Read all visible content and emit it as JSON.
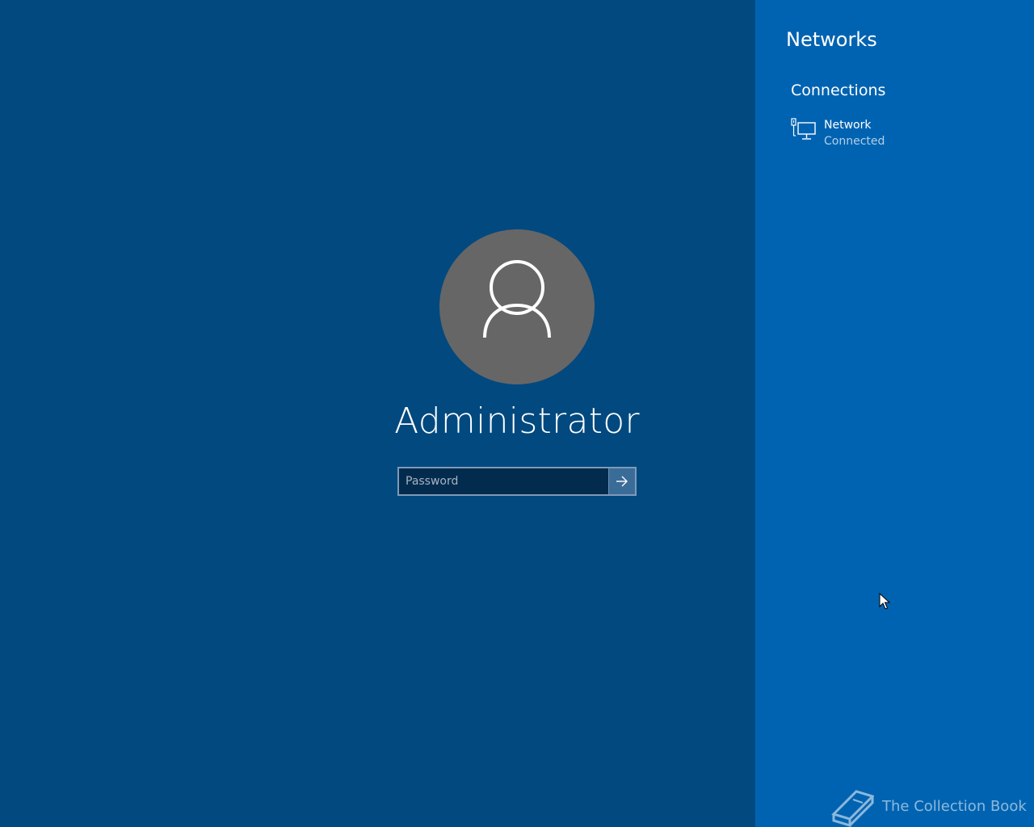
{
  "login": {
    "username": "Administrator",
    "password_placeholder": "Password",
    "password_value": "",
    "avatar_icon": "user-silhouette-icon",
    "submit_icon": "arrow-right-icon"
  },
  "networks_panel": {
    "title": "Networks",
    "section_title": "Connections",
    "connections": [
      {
        "name": "Network",
        "status": "Connected",
        "icon": "wired-network-icon"
      }
    ]
  },
  "watermark": {
    "text": "The Collection Book",
    "icon": "book-icon"
  },
  "colors": {
    "background": "#02497f",
    "panel": "#0063b1",
    "avatar": "#666666",
    "password_field": "#022b4d",
    "submit_button": "#3a6c98"
  }
}
